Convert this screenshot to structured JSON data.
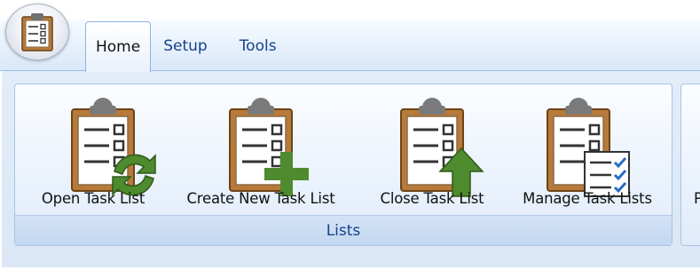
{
  "app": {
    "orb_icon": "task-list-icon"
  },
  "tabs": [
    {
      "label": "Home",
      "active": true
    },
    {
      "label": "Setup",
      "active": false
    },
    {
      "label": "Tools",
      "active": false
    }
  ],
  "ribbon": {
    "groups": [
      {
        "label": "Lists",
        "buttons": [
          {
            "label": "Open Task List",
            "icon": "open-task-list-icon"
          },
          {
            "label": "Create New Task List",
            "icon": "create-task-list-icon"
          },
          {
            "label": "Close Task List",
            "icon": "close-task-list-icon"
          },
          {
            "label": "Manage Task Lists",
            "icon": "manage-task-lists-icon"
          }
        ]
      }
    ],
    "next_group_partial_label": "P"
  },
  "colors": {
    "clipboard_brown": "#b77a3a",
    "clip_gray": "#7a7a7a",
    "green": "#4e8a2e",
    "tab_text": "#15428b",
    "group_border": "#a7c3e6"
  }
}
